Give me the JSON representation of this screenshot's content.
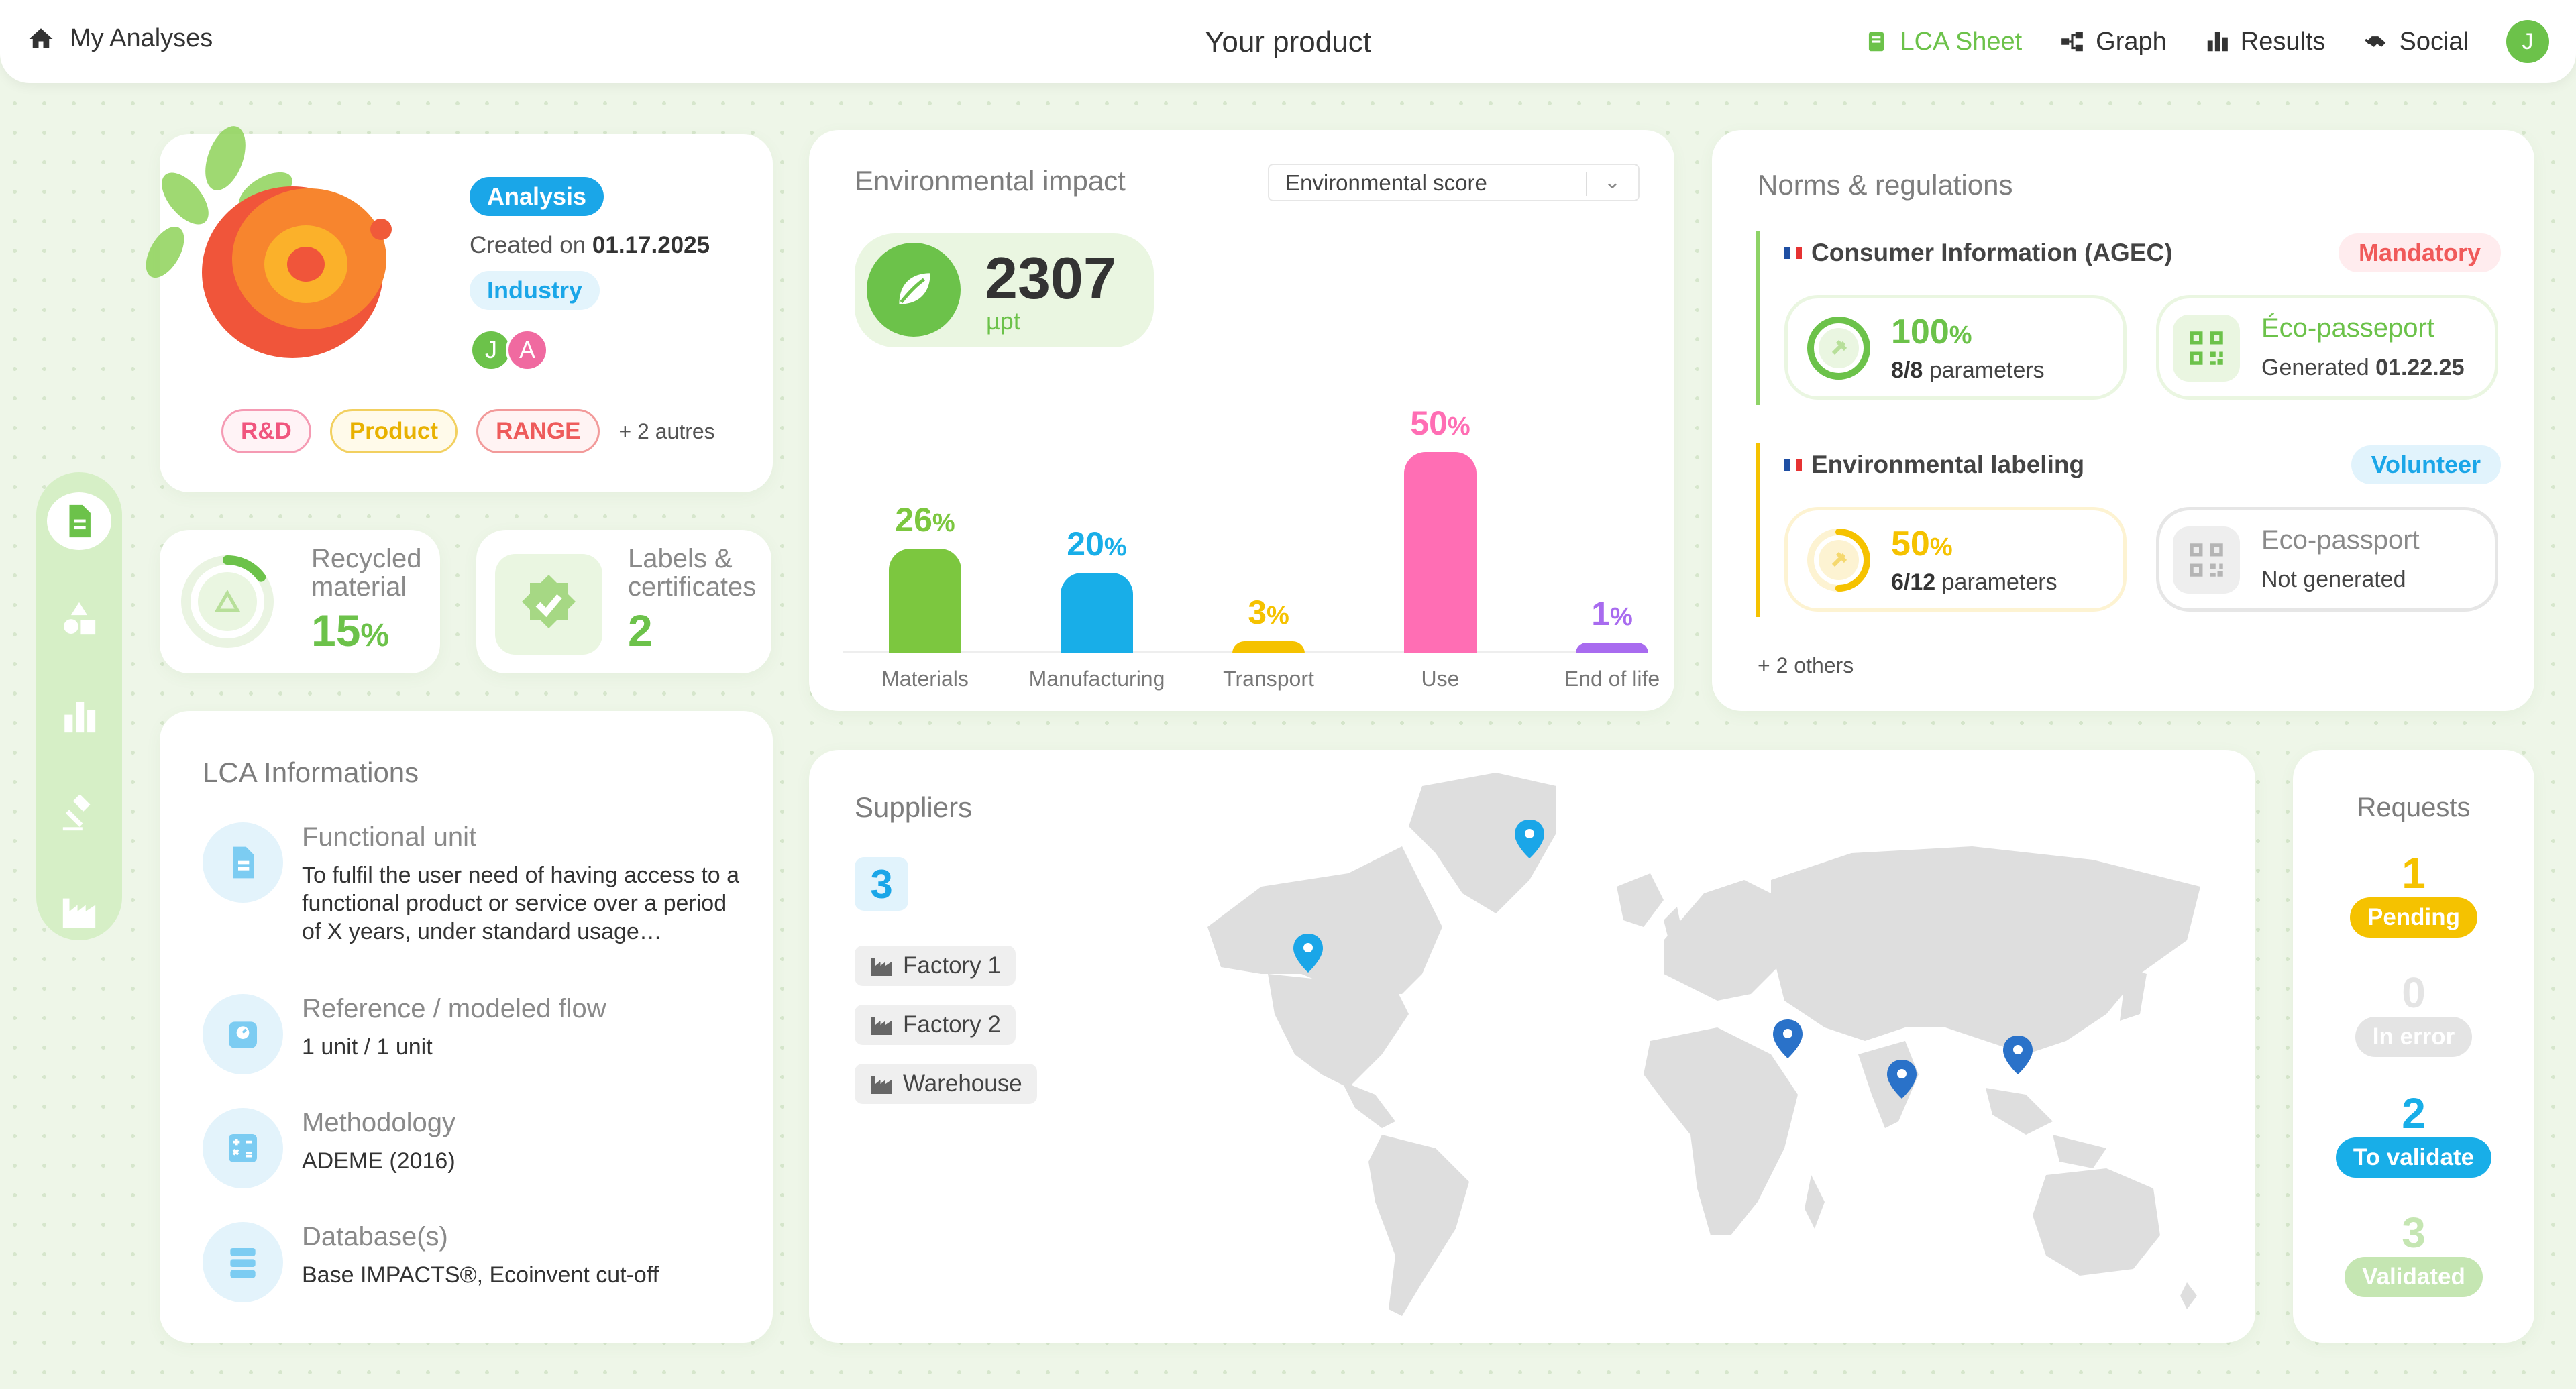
{
  "topbar": {
    "home_label": "My Analyses",
    "title": "Your product",
    "nav": [
      {
        "label": "LCA Sheet",
        "icon": "lca-sheet-icon",
        "active": true
      },
      {
        "label": "Graph",
        "icon": "graph-icon",
        "active": false
      },
      {
        "label": "Results",
        "icon": "results-icon",
        "active": false
      },
      {
        "label": "Social",
        "icon": "social-icon",
        "active": false
      }
    ],
    "user_initial": "J"
  },
  "sidebar": {
    "items": [
      {
        "icon": "document-icon",
        "active": true
      },
      {
        "icon": "shapes-icon",
        "active": false
      },
      {
        "icon": "bar-chart-icon",
        "active": false
      },
      {
        "icon": "gavel-icon",
        "active": false
      },
      {
        "icon": "factory-icon",
        "active": false
      }
    ]
  },
  "product": {
    "type_badge": "Analysis",
    "created_prefix": "Created on ",
    "created_date": "01.17.2025",
    "sector_badge": "Industry",
    "avatars": [
      "J",
      "A"
    ],
    "tags": [
      "R&D",
      "Product",
      "RANGE"
    ],
    "more_tags": "+ 2 autres"
  },
  "recycled": {
    "label_line1": "Recycled",
    "label_line2": "material",
    "value": "15",
    "unit": "%",
    "fraction": 0.15
  },
  "labels": {
    "label_line1": "Labels &",
    "label_line2": "certificates",
    "value": "2"
  },
  "lca": {
    "title": "LCA Informations",
    "items": [
      {
        "icon": "document-icon",
        "label": "Functional unit",
        "value": "To fulfil the user need of having access to a functional product or service over a period of X years, under standard usage…"
      },
      {
        "icon": "scale-icon",
        "label": "Reference / modeled flow",
        "value": "1 unit / 1 unit"
      },
      {
        "icon": "calculator-icon",
        "label": "Methodology",
        "value": "ADEME (2016)"
      },
      {
        "icon": "database-icon",
        "label": "Database(s)",
        "value": "Base IMPACTS®, Ecoinvent cut-off"
      }
    ]
  },
  "env": {
    "title": "Environmental impact",
    "dropdown_value": "Environmental score",
    "score": "2307",
    "score_unit": "µpt"
  },
  "chart_data": {
    "type": "bar",
    "categories": [
      "Materials",
      "Manufacturing",
      "Transport",
      "Use",
      "End of life"
    ],
    "values": [
      26,
      20,
      3,
      50,
      1
    ],
    "unit": "%",
    "colors": [
      "#7cc73f",
      "#18aee8",
      "#f5c200",
      "#ff6eb4",
      "#a86bef"
    ],
    "ylim": [
      0,
      50
    ]
  },
  "norms": {
    "title": "Norms & regulations",
    "blocks": [
      {
        "title": "Consumer Information (AGEC)",
        "status": "Mandatory",
        "progress_value": "100",
        "progress_unit": "%",
        "progress_fraction": 1.0,
        "params_count": "8/8",
        "params_label": " parameters",
        "passport_label": "Éco-passeport",
        "passport_status": "Generated ",
        "passport_date": "01.22.25"
      },
      {
        "title": "Environmental labeling",
        "status": "Volunteer",
        "progress_value": "50",
        "progress_unit": "%",
        "progress_fraction": 0.5,
        "params_count": "6/12",
        "params_label": " parameters",
        "passport_label": "Eco-passport",
        "passport_status": "Not generated",
        "passport_date": ""
      }
    ],
    "others": "+ 2 others"
  },
  "suppliers": {
    "title": "Suppliers",
    "count": "3",
    "items": [
      "Factory 1",
      "Factory 2",
      "Warehouse"
    ]
  },
  "requests": {
    "title": "Requests",
    "rows": [
      {
        "count": "1",
        "label": "Pending",
        "color": "#f5c200"
      },
      {
        "count": "0",
        "label": "In error",
        "color": "#e4e4e4"
      },
      {
        "count": "2",
        "label": "To validate",
        "color": "#18aee8"
      },
      {
        "count": "3",
        "label": "Validated",
        "color": "#c5e6b2"
      }
    ]
  }
}
